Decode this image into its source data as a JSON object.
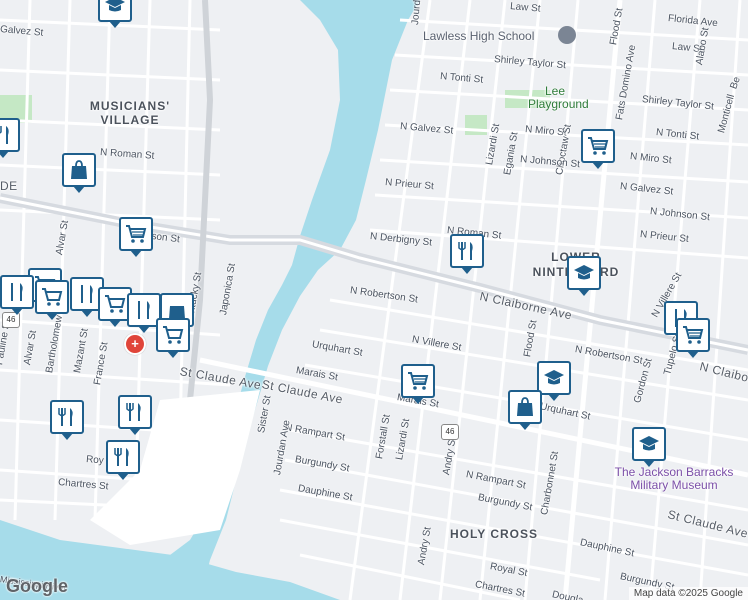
{
  "map": {
    "colors": {
      "water": "#a6dcea",
      "land": "#eef0f3",
      "road": "#ffffff",
      "highway": "#d6dae0",
      "park": "#c5e8c5",
      "pin": "#1f5f8c"
    },
    "streets": [
      {
        "id": "galvez-st-w",
        "text": "Galvez St"
      },
      {
        "id": "n-roman-st",
        "text": "N Roman St"
      },
      {
        "id": "n-johnson-st-w",
        "text": "N Johnson St"
      },
      {
        "id": "japonica-st",
        "text": "Japonica St"
      },
      {
        "id": "kentucky-st",
        "text": "Kentucky St"
      },
      {
        "id": "st-claude-ave-w",
        "text": "St Claude Ave"
      },
      {
        "id": "chartres-st-w",
        "text": "Chartres St"
      },
      {
        "id": "royal-w",
        "text": "Roy"
      },
      {
        "id": "pauline-st",
        "text": "Pauline St"
      },
      {
        "id": "alvar-st",
        "text": "Alvar St"
      },
      {
        "id": "bartholomew-st",
        "text": "Bartholomew St"
      },
      {
        "id": "mazant-st",
        "text": "Mazant St"
      },
      {
        "id": "france-st",
        "text": "France St"
      },
      {
        "id": "alvar-st-n",
        "text": "Alvar St"
      },
      {
        "id": "desire",
        "text": "DE"
      },
      {
        "id": "florida-ave",
        "text": "Florida Ave"
      },
      {
        "id": "law-st",
        "text": "Law St"
      },
      {
        "id": "law-st-e",
        "text": "Law St"
      },
      {
        "id": "fats-domino-ave",
        "text": "Fats Domino Ave"
      },
      {
        "id": "flood-st-n",
        "text": "Flood St"
      },
      {
        "id": "alabo-st",
        "text": "Alabo St"
      },
      {
        "id": "n-tonti-st",
        "text": "N Tonti St"
      },
      {
        "id": "n-tonti-st-e",
        "text": "N Tonti St"
      },
      {
        "id": "shirley-taylor-st",
        "text": "Shirley Taylor St"
      },
      {
        "id": "shirley-taylor-st-e",
        "text": "Shirley Taylor St"
      },
      {
        "id": "n-galvez-st",
        "text": "N Galvez St"
      },
      {
        "id": "n-galvez-st-e",
        "text": "N Galvez St"
      },
      {
        "id": "n-miro-st",
        "text": "N Miro St"
      },
      {
        "id": "n-miro-st-e",
        "text": "N Miro St"
      },
      {
        "id": "lizardi-st-n",
        "text": "Lizardi St"
      },
      {
        "id": "egania-st",
        "text": "Egania St"
      },
      {
        "id": "choctaw-st",
        "text": "Choctaw St"
      },
      {
        "id": "n-prieur-st",
        "text": "N Prieur St"
      },
      {
        "id": "n-prieur-st-e",
        "text": "N Prieur St"
      },
      {
        "id": "n-johnson-st",
        "text": "N Johnson St"
      },
      {
        "id": "n-johnson-st-e",
        "text": "N Johnson St"
      },
      {
        "id": "n-derbigny-st",
        "text": "N Derbigny St"
      },
      {
        "id": "n-roman-st-e",
        "text": "N Roman St"
      },
      {
        "id": "n-robertson-st",
        "text": "N Robertson St"
      },
      {
        "id": "n-robertson-st-e",
        "text": "N Robertson St"
      },
      {
        "id": "n-claiborne-ave",
        "text": "N Claiborne Ave"
      },
      {
        "id": "n-claiborne-ave-e",
        "text": "N Claiborne Ave"
      },
      {
        "id": "n-villere-st",
        "text": "N Villere St"
      },
      {
        "id": "n-villere-st-e",
        "text": "N Villere St"
      },
      {
        "id": "urquhart-st",
        "text": "Urquhart St"
      },
      {
        "id": "urquhart-st-e",
        "text": "Urquhart St"
      },
      {
        "id": "marais-st",
        "text": "Marais St"
      },
      {
        "id": "marais-st-e",
        "text": "Marais St"
      },
      {
        "id": "st-claude-ave",
        "text": "St Claude Ave"
      },
      {
        "id": "st-claude-ave-e",
        "text": "St Claude Ave"
      },
      {
        "id": "n-rampart-st",
        "text": "N Rampart St"
      },
      {
        "id": "n-rampart-st-e",
        "text": "N Rampart St"
      },
      {
        "id": "burgundy-st",
        "text": "Burgundy St"
      },
      {
        "id": "burgundy-st-e",
        "text": "Burgundy St"
      },
      {
        "id": "burgundy-st-e2",
        "text": "Burgundy St"
      },
      {
        "id": "dauphine-st",
        "text": "Dauphine St"
      },
      {
        "id": "dauphine-st-e",
        "text": "Dauphine St"
      },
      {
        "id": "royal-st",
        "text": "Royal St"
      },
      {
        "id": "chartres-st",
        "text": "Chartres St"
      },
      {
        "id": "sister-st",
        "text": "Sister St"
      },
      {
        "id": "jourdan-ave",
        "text": "Jourdan Ave"
      },
      {
        "id": "jourdan-ave-n",
        "text": "Jourdan Ave"
      },
      {
        "id": "forstall-st",
        "text": "Forstall St"
      },
      {
        "id": "lizardi-st",
        "text": "Lizardi St"
      },
      {
        "id": "andry-st",
        "text": "Andry St"
      },
      {
        "id": "andry-st-s",
        "text": "Andry St"
      },
      {
        "id": "flood-st",
        "text": "Flood St"
      },
      {
        "id": "charbonnet-st",
        "text": "Charbonnet St"
      },
      {
        "id": "gordon-st",
        "text": "Gordon St"
      },
      {
        "id": "tupelo-st",
        "text": "Tupelo St"
      },
      {
        "id": "monticello",
        "text": "Monticell"
      },
      {
        "id": "bell",
        "text": "Be"
      },
      {
        "id": "douglas",
        "text": "Dougla"
      },
      {
        "id": "mississippi-river",
        "text": "Mississippi River"
      }
    ],
    "places": {
      "lawless": "Lawless High School",
      "lee": "Lee Playground",
      "musicians_village": "MUSICIANS' VILLAGE",
      "lower_ninth": "LOWER NINTH WARD",
      "holy_cross": "HOLY CROSS",
      "jackson_barracks": "The Jackson Barracks Military Museum"
    },
    "route_shields": [
      "46",
      "46"
    ],
    "pin_icons": [
      "restaurant-icon",
      "shopping-cart-icon",
      "shopping-bag-icon",
      "school-icon"
    ],
    "branding": {
      "logo": "Google",
      "attribution": "Map data ©2025 Google"
    }
  }
}
